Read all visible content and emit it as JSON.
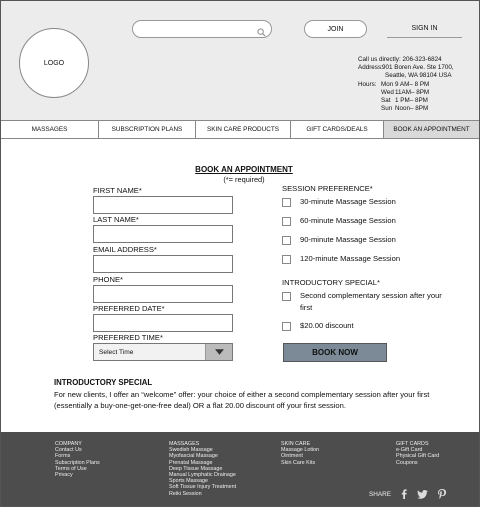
{
  "header": {
    "logo": "LOGO",
    "join": "JOIN",
    "sign_in": "SIGN IN",
    "contact": {
      "call_label": "Call us directly:",
      "phone": "206-323-6824",
      "address_label": "Address:",
      "address_line1": "901 Boren Ave. Ste 1700,",
      "address_line2": "Seattle, WA 98104 USA",
      "hours_label": "Hours:",
      "hours": [
        {
          "day": "Mon",
          "time": "9 AM– 8 PM"
        },
        {
          "day": "Wed",
          "time": "11AM– 8PM"
        },
        {
          "day": "Sat",
          "time": "1 PM– 8PM"
        },
        {
          "day": "Sun",
          "time": "Noon– 8PM"
        }
      ]
    }
  },
  "nav": {
    "tabs": [
      "MASSAGES",
      "SUBSCRIPTION PLANS",
      "SKIN CARE PRODUCTS",
      "GIFT CARDS/DEALS",
      "BOOK AN APPOINTMENT"
    ],
    "active": "BOOK AN APPOINTMENT"
  },
  "form": {
    "title": "BOOK AN APPOINTMENT",
    "required_note": "(*= required)",
    "fields": {
      "first_name": "FIRST NAME*",
      "last_name": "LAST NAME*",
      "email": "EMAIL ADDRESS*",
      "phone": "PHONE*",
      "preferred_date": "PREFERRED DATE*",
      "preferred_time": "PREFERRED TIME*"
    },
    "time_select": "Select Time",
    "session_title": "SESSION PREFERENCE*",
    "sessions": [
      "30-minute Massage Session",
      "60-minute Massage Session",
      "90-minute Massage Session",
      "120-minute Massage Session"
    ],
    "special_title": "INTRODUCTORY SPECIAL*",
    "special_opt1_line1": "Second complementary session after your",
    "special_opt1_line2": "first",
    "special_opt2": "$20.00 discount",
    "book_button": "BOOK NOW"
  },
  "intro": {
    "title": "INTRODUCTORY SPECIAL",
    "body": "For new clients, I offer an “welcome” offer: your choice of either a second complementary session after your first (essentially a buy-one-get-one-free deal) OR a flat 20.00 discount off your first session."
  },
  "footer": {
    "company": [
      "COMPANY",
      "Contact Us",
      "Forms",
      "Subscription Plans",
      "Terms of Use",
      "Privacy"
    ],
    "massages": [
      "MASSAGES",
      "Swedish Massage",
      "Myofascial Massage",
      "Prenatal Massage",
      "Deep Tissue Massage",
      "Manual Lymphatic Drainage",
      "Sports Massage",
      "Soft Tissue Injury Treatment",
      "Reiki Session"
    ],
    "skin_care": [
      "SKIN CARE",
      "Massage Lotion",
      "Ointment",
      "Skin Care Kits"
    ],
    "gift_cards": [
      "GIFT CARDS",
      "e-Gift Card",
      "Physical Gift Card",
      "Coupons"
    ],
    "share_label": "SHARE",
    "share_icons": [
      "facebook-icon",
      "twitter-icon",
      "pinterest-icon"
    ]
  }
}
